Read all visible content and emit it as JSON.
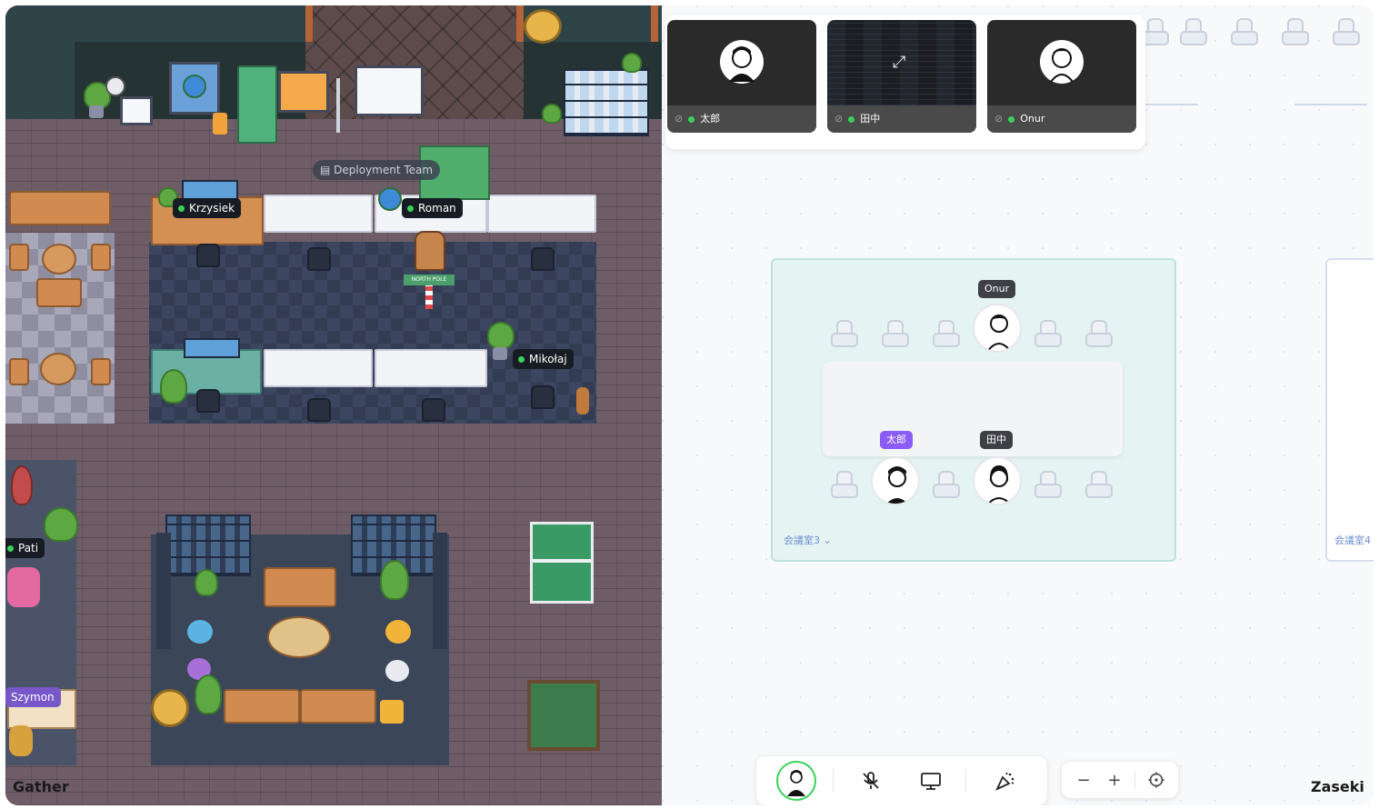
{
  "gather": {
    "app_label": "Gather",
    "zone_label": "Deployment Team",
    "sign_text": "NORTH POLE",
    "players": [
      {
        "name": "Krzysiek"
      },
      {
        "name": "Roman"
      },
      {
        "name": "Mikołaj"
      },
      {
        "name": "Pati"
      },
      {
        "name": "Szymon"
      }
    ]
  },
  "zaseki": {
    "app_label": "Zaseki",
    "video_tiles": [
      {
        "name": "太郎",
        "type": "camera"
      },
      {
        "name": "田中",
        "type": "screen-share"
      },
      {
        "name": "Onur",
        "type": "camera"
      }
    ],
    "room": {
      "label": "会議室3",
      "occupants": [
        {
          "name": "Onur"
        },
        {
          "name": "太郎"
        },
        {
          "name": "田中"
        }
      ]
    },
    "room_next_label": "会議室4",
    "toolbar": {
      "items": [
        "avatar",
        "mic-muted-icon",
        "screen-share-icon",
        "effects-icon"
      ]
    },
    "zoom": {
      "minus": "−",
      "plus": "+"
    }
  },
  "colors": {
    "online": "#3ad25a",
    "tag_purple": "#8b5cf6",
    "room_bg": "#e5f4f2"
  }
}
